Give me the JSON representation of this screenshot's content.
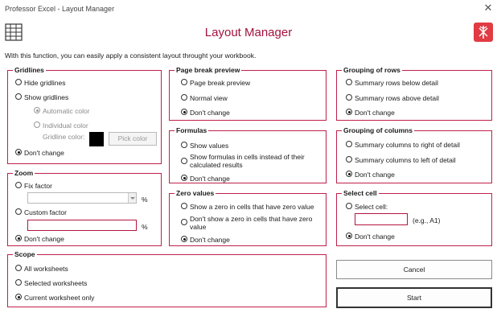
{
  "window": {
    "title": "Professor Excel - Layout Manager",
    "close_icon": "close-icon"
  },
  "header": {
    "title": "Layout Manager",
    "icon_left": "grid-layout-icon",
    "logo": "professor-excel-logo",
    "accent_color": "#a3123c",
    "logo_color": "#e13b43"
  },
  "intro": "With this function, you can easily apply a consistent layout throught your workbook.",
  "gridlines": {
    "legend": "Gridlines",
    "hide": "Hide gridlines",
    "show": "Show gridlines",
    "automatic_color": "Automatic color",
    "individual_color": "Individual color",
    "gridline_color_label": "Gridline color:",
    "gridline_color_value": "#000000",
    "pick_color": "Pick color",
    "dont_change": "Don't change"
  },
  "zoom": {
    "legend": "Zoom",
    "fix_factor": "Fix factor",
    "fix_value": "",
    "percent1": "%",
    "custom_factor": "Custom factor",
    "custom_value": "",
    "percent2": "%",
    "dont_change": "Don't change"
  },
  "scope": {
    "legend": "Scope",
    "all": "All worksheets",
    "selected": "Selected worksheets",
    "current": "Current worksheet only"
  },
  "page_break": {
    "legend": "Page break preview",
    "preview": "Page break preview",
    "normal": "Normal view",
    "dont_change": "Don't change"
  },
  "formulas": {
    "legend": "Formulas",
    "show_values": "Show values",
    "show_formulas": "Show formulas in cells instead of their calculated results",
    "dont_change": "Don't change"
  },
  "zero_values": {
    "legend": "Zero values",
    "show_zero": "Show a zero in cells that have zero value",
    "dont_show_zero": "Don't show a zero in cells that have zero value",
    "dont_change": "Don't change"
  },
  "grouping_rows": {
    "legend": "Grouping of rows",
    "below": "Summary rows below detail",
    "above": "Summary rows above detail",
    "dont_change": "Don't change"
  },
  "grouping_columns": {
    "legend": "Grouping of columns",
    "right": "Summary columns to right of detail",
    "left": "Summary columns to left of detail",
    "dont_change": "Don't change"
  },
  "select_cell": {
    "legend": "Select cell",
    "select_cell": "Select cell:",
    "cell_value": "",
    "example": "(e.g., A1)",
    "dont_change": "Don't change"
  },
  "actions": {
    "cancel": "Cancel",
    "start": "Start"
  }
}
